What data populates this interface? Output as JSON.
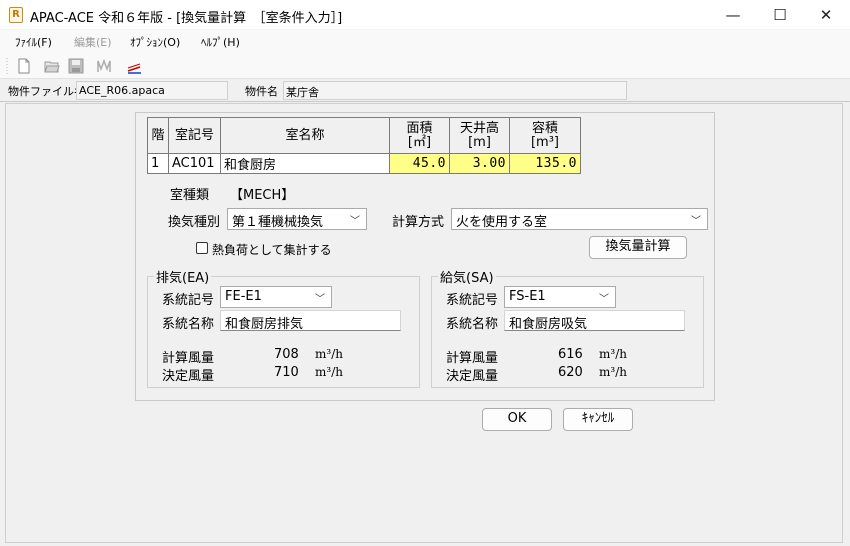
{
  "window": {
    "title": "APAC-ACE 令和６年版 - [換気量計算　［室条件入力］]",
    "minimize": "—",
    "maximize": "☐",
    "close": "✕"
  },
  "menu": {
    "file": "ﾌｧｲﾙ(F)",
    "edit": "編集(E)",
    "option": "ｵﾌﾟｼｮﾝ(O)",
    "help": "ﾍﾙﾌﾟ(H)"
  },
  "info": {
    "file_label": "物件ファイル名",
    "file_value": "ACE_R06.apaca",
    "name_label": "物件名",
    "name_value": "某庁舎"
  },
  "table": {
    "headers": {
      "floor": "階",
      "room_code": "室記号",
      "room_name": "室名称",
      "area": "面積",
      "area_unit": "[㎡]",
      "ceiling": "天井高",
      "ceiling_unit": "[m]",
      "volume": "容積",
      "volume_unit": "[m³]"
    },
    "row": {
      "floor": "1",
      "room_code": "AC101",
      "room_name": "和食厨房",
      "area": "45.0",
      "ceiling": "3.00",
      "volume": "135.0"
    }
  },
  "form": {
    "room_type_label": "室種類",
    "room_type_value": "【MECH】",
    "vent_type_label": "換気種別",
    "vent_type_value": "第１種機械換気",
    "calc_method_label": "計算方式",
    "calc_method_value": "火を使用する室",
    "heat_load_label": "熱負荷として集計する",
    "calc_button": "換気量計算"
  },
  "exhaust": {
    "title": "排気(EA)",
    "system_code_label": "系統記号",
    "system_code_value": "FE-E1",
    "system_name_label": "系統名称",
    "system_name_value": "和食厨房排気",
    "calc_flow_label": "計算風量",
    "calc_flow_value": "708",
    "decided_flow_label": "決定風量",
    "decided_flow_value": "710",
    "unit": "m³/h"
  },
  "supply": {
    "title": "給気(SA)",
    "system_code_label": "系統記号",
    "system_code_value": "FS-E1",
    "system_name_label": "系統名称",
    "system_name_value": "和食厨房吸気",
    "calc_flow_label": "計算風量",
    "calc_flow_value": "616",
    "decided_flow_label": "決定風量",
    "decided_flow_value": "620",
    "unit": "m³/h"
  },
  "buttons": {
    "ok": "OK",
    "cancel": "ｷｬﾝｾﾙ"
  },
  "colors": {
    "highlight_cell": "#ffff88",
    "app_icon": "#d08a10"
  }
}
